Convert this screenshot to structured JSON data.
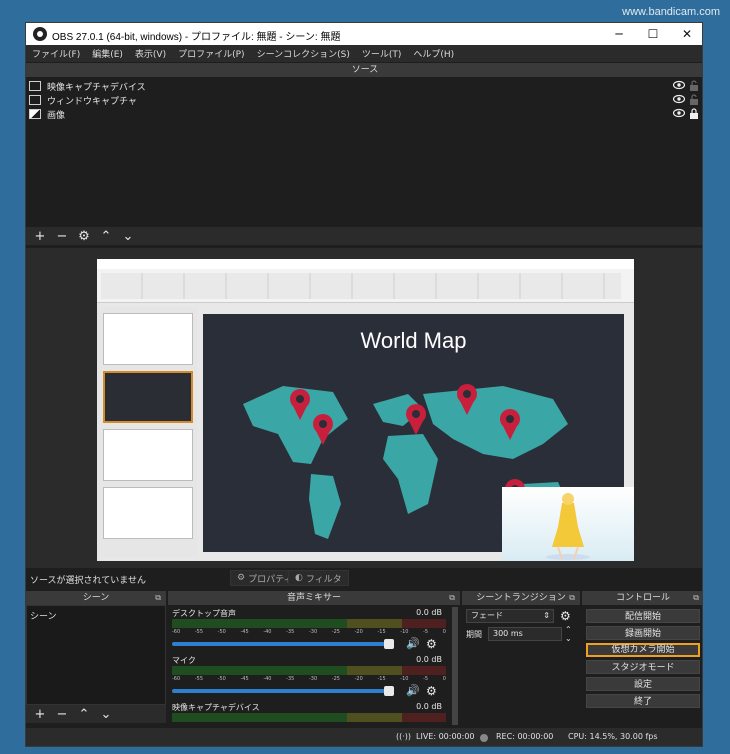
{
  "watermark": "www.bandicam.com",
  "window": {
    "title": "OBS 27.0.1 (64-bit, windows) - プロファイル: 無題 - シーン: 無題",
    "min": "─",
    "max": "☐",
    "close": "✕"
  },
  "menu": [
    "ファイル(F)",
    "編集(E)",
    "表示(V)",
    "プロファイル(P)",
    "シーンコレクション(S)",
    "ツール(T)",
    "ヘルプ(H)"
  ],
  "sources": {
    "title": "ソース",
    "items": [
      {
        "label": "映像キャプチャデバイス",
        "icon": "camera-icon"
      },
      {
        "label": "ウィンドウキャプチャ",
        "icon": "window-icon"
      },
      {
        "label": "画像",
        "icon": "image-icon"
      }
    ],
    "toolbar": [
      "+",
      "−",
      "⚙",
      "⌃",
      "⌄"
    ]
  },
  "preview": {
    "slide_title": "World Map"
  },
  "status_strip": {
    "no_source": "ソースが選択されていません",
    "properties": "プロパティ",
    "filters": "フィルタ"
  },
  "scenes": {
    "title": "シーン",
    "items": [
      "シーン"
    ],
    "toolbar": [
      "+",
      "−",
      "⌃",
      "⌄"
    ]
  },
  "mixer": {
    "title": "音声ミキサー",
    "scale_labels": [
      "-60",
      "-55",
      "-50",
      "-45",
      "-40",
      "-35",
      "-30",
      "-25",
      "-20",
      "-15",
      "-10",
      "-5",
      "0"
    ],
    "channels": [
      {
        "name": "デスクトップ音声",
        "db": "0.0 dB",
        "level": 0.96
      },
      {
        "name": "マイク",
        "db": "0.0 dB",
        "level": 0.96
      },
      {
        "name": "映像キャプチャデバイス",
        "db": "0.0 dB",
        "level": 0.96
      }
    ]
  },
  "transitions": {
    "title": "シーントランジション",
    "type": "フェード",
    "duration_label": "期間",
    "duration_value": "300 ms"
  },
  "controls": {
    "title": "コントロール",
    "buttons": [
      "配信開始",
      "録画開始",
      "仮想カメラ開始",
      "スタジオモード",
      "設定",
      "終了"
    ],
    "highlighted_index": 2
  },
  "statusbar": {
    "live": "LIVE: 00:00:00",
    "rec": "REC: 00:00:00",
    "cpu": "CPU: 14.5%, 30.00 fps"
  },
  "colors": {
    "accent_highlight": "#f0a020",
    "slider": "#2f7fd0",
    "map": "#3aa7a6",
    "pin": "#c8203c"
  }
}
